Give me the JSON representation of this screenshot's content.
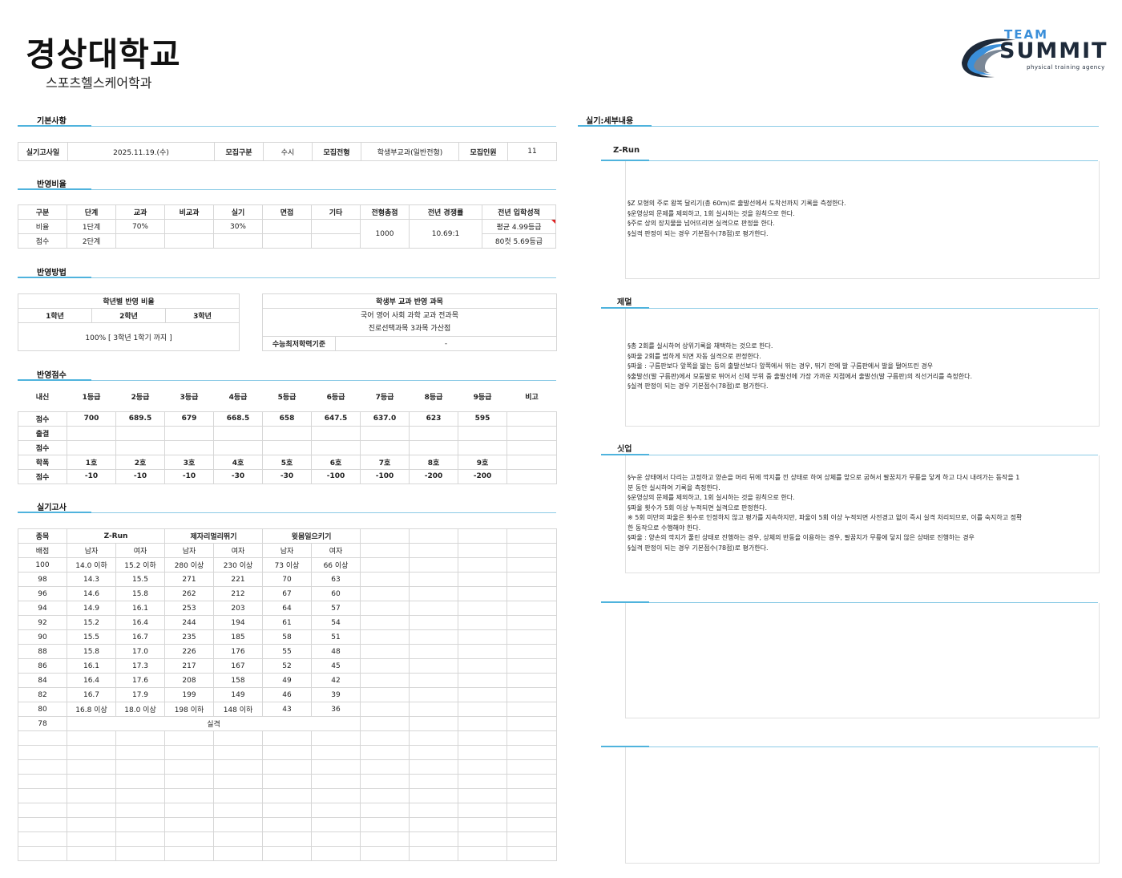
{
  "header": {
    "university": "경상대학교",
    "department": "스포츠헬스케어학과",
    "logo": {
      "top": "TEAM",
      "main": "SUMMIT",
      "tagline": "physical training agency"
    }
  },
  "basic": {
    "section_title": "기본사항",
    "cells": [
      "실기고사일",
      "2025.11.19.(수)",
      "모집구분",
      "수시",
      "모집전형",
      "학생부교과(일반전형)",
      "모집인원",
      "11"
    ]
  },
  "ratio": {
    "section_title": "반영비율",
    "headers": [
      "구분",
      "단계",
      "교과",
      "비교과",
      "실기",
      "면접",
      "기타",
      "전형총점",
      "전년 경쟁률",
      "전년 입학성적"
    ],
    "row1": [
      "비율",
      "1단계",
      "70%",
      "",
      "30%",
      "",
      ""
    ],
    "row2": [
      "점수",
      "2단계",
      "",
      "",
      "",
      "",
      ""
    ],
    "total": "1000",
    "competition": "10.69:1",
    "prev_scores": [
      "평균 4.99등급",
      "80컷 5.69등급"
    ]
  },
  "method": {
    "section_title": "반영방법",
    "grade_title": "학년별 반영 비율",
    "grade_headers": [
      "1학년",
      "2학년",
      "3학년"
    ],
    "grade_value": "100% [ 3학년 1학기 까지 ]",
    "subject_title": "학생부 교과 반영 과목",
    "subject_lines": [
      "국어 영어 사회 과학 교과 전과목",
      "진로선택과목 3과목 가산점"
    ],
    "csat_label": "수능최저학력기준",
    "csat_value": "-"
  },
  "score": {
    "section_title": "반영점수",
    "headers": [
      "내신",
      "1등급",
      "2등급",
      "3등급",
      "4등급",
      "5등급",
      "6등급",
      "7등급",
      "8등급",
      "9등급",
      "비고"
    ],
    "rows": [
      [
        "점수",
        "700",
        "689.5",
        "679",
        "668.5",
        "658",
        "647.5",
        "637.0",
        "623",
        "595",
        ""
      ],
      [
        "출결",
        "",
        "",
        "",
        "",
        "",
        "",
        "",
        "",
        "",
        ""
      ],
      [
        "점수",
        "",
        "",
        "",
        "",
        "",
        "",
        "",
        "",
        "",
        ""
      ],
      [
        "학폭",
        "1호",
        "2호",
        "3호",
        "4호",
        "5호",
        "6호",
        "7호",
        "8호",
        "9호",
        ""
      ],
      [
        "점수",
        "-10",
        "-10",
        "-10",
        "-30",
        "-30",
        "-100",
        "-100",
        "-200",
        "-200",
        ""
      ]
    ]
  },
  "practical": {
    "section_title": "실기고사",
    "head1": [
      "종목",
      "Z-Run",
      "제자리멀리뛰기",
      "윗몸일으키기"
    ],
    "head2": [
      "배점",
      "남자",
      "여자",
      "남자",
      "여자",
      "남자",
      "여자"
    ],
    "rows": [
      [
        "100",
        "14.0 이하",
        "15.2 이하",
        "280 이상",
        "230 이상",
        "73 이상",
        "66 이상"
      ],
      [
        "98",
        "14.3",
        "15.5",
        "271",
        "221",
        "70",
        "63"
      ],
      [
        "96",
        "14.6",
        "15.8",
        "262",
        "212",
        "67",
        "60"
      ],
      [
        "94",
        "14.9",
        "16.1",
        "253",
        "203",
        "64",
        "57"
      ],
      [
        "92",
        "15.2",
        "16.4",
        "244",
        "194",
        "61",
        "54"
      ],
      [
        "90",
        "15.5",
        "16.7",
        "235",
        "185",
        "58",
        "51"
      ],
      [
        "88",
        "15.8",
        "17.0",
        "226",
        "176",
        "55",
        "48"
      ],
      [
        "86",
        "16.1",
        "17.3",
        "217",
        "167",
        "52",
        "45"
      ],
      [
        "84",
        "16.4",
        "17.6",
        "208",
        "158",
        "49",
        "42"
      ],
      [
        "82",
        "16.7",
        "17.9",
        "199",
        "149",
        "46",
        "39"
      ],
      [
        "80",
        "16.8 이상",
        "18.0 이상",
        "198 이하",
        "148 이하",
        "43",
        "36"
      ]
    ],
    "fail_score": "78",
    "fail_label": "실격"
  },
  "details": {
    "section_title": "실기:세부내용",
    "items": [
      {
        "title": "Z-Run",
        "lines": [
          "§Z 모형의 주로 왕복 달리기(총 60m)로 출발선에서 도착선까지 기록을 측정한다.",
          "§운영상의 문제를 제외하고, 1회 실시하는 것을 원칙으로 한다.",
          "§주로 상의 장치물을 넘어뜨리면 실격으로 판정을 한다.",
          "§실격 판정이 되는 경우 기본점수(78점)로 평가한다."
        ]
      },
      {
        "title": "제멀",
        "lines": [
          "§총 2회를 실시하여 상위기록을 채택하는 것으로 한다.",
          "§파울 2회를 범하게 되면 자동 실격으로 판정한다.",
          "§파울 : 구름판보다 앞쪽을 밟는 등의 출발선보다 앞쪽에서 뛰는 경우, 뛰기 전에 발 구름판에서 발을 떨어뜨린 경우",
          "§출발선(발 구름판)에서 모둠발로 뛰어서 신체 부위 중 출발선에 가장 가까운 지점에서 출발선(발 구름판)의 직선거리를 측정한다.",
          "§실격 판정이 되는 경우 기본점수(78점)로 평가한다."
        ]
      },
      {
        "title": "싯업",
        "lines": [
          "§누운 상태에서 다리는 고정하고 양손을 머리 뒤에 깍지를 낀 상태로 하여 상체를 앞으로 굽혀서 팔꿈치가 무릎을 닿게 하고 다시 내려가는 동작을 1",
          "분 동안 실시하여 기록을 측정한다.",
          "§운영상의 문제를 제외하고, 1회 실시하는 것을 원칙으로 한다.",
          "§파울 횟수가 5회 이상 누적되면 실격으로 판정한다.",
          "※ 5회 미만의 파울은 횟수로 인정하지 않고 평가를 지속하지만, 파울이 5회 이상 누적되면 사전경고 없이 즉시 실격 처리되므로, 이를 숙지하고 정확",
          "한 동작으로 수행해야 한다.",
          "§파울 : 양손의 깍지가 풀린 상태로 진행하는 경우, 상체의 반동을 이용하는 경우, 팔꿈치가 무릎에 닿지 않은 상태로 진행하는 경우",
          "§실격 판정이 되는 경우 기본점수(78점)로 평가한다."
        ]
      }
    ]
  },
  "colors": {
    "accent_line": "#8ccbe6",
    "accent_mark": "#4fb3dd",
    "grid": "#d6d6d6",
    "logo_blue": "#3b8fd9",
    "logo_dark": "#1e2a3a"
  }
}
